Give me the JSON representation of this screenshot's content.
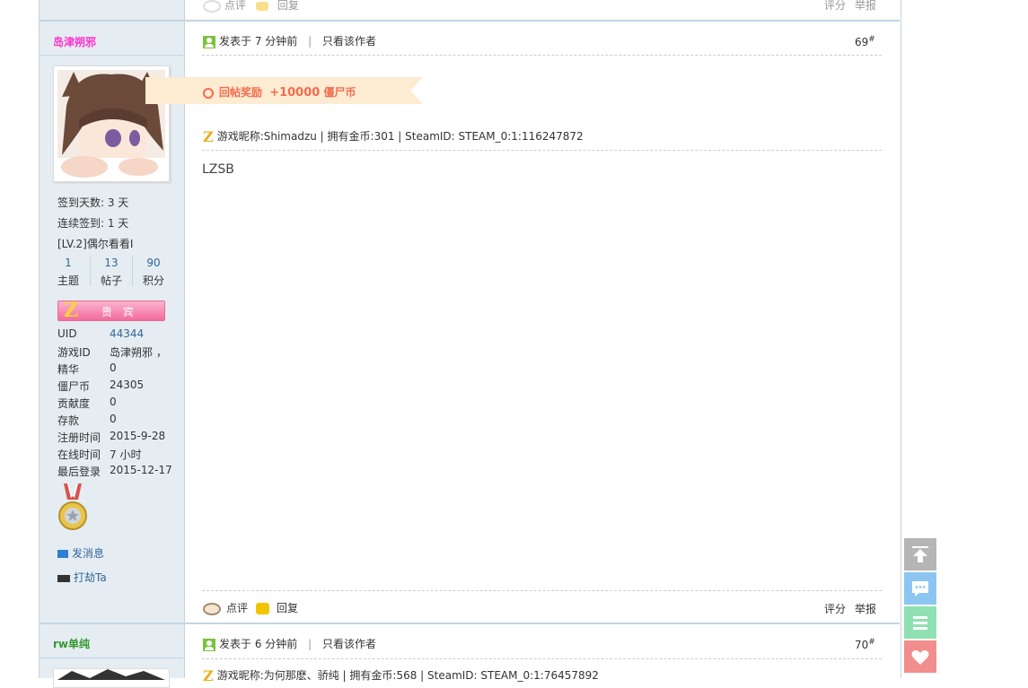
{
  "prev_post": {
    "comment": "点评",
    "reply": "回复",
    "rate": "评分",
    "report": "举报"
  },
  "post69": {
    "author": {
      "name": "岛津朔邪",
      "checkin_days": "签到天数: 3 天",
      "streak": "连续签到: 1 天",
      "level": "[LV.2]偶尔看看I",
      "stats": [
        {
          "value": "1",
          "label": "主题"
        },
        {
          "value": "13",
          "label": "帖子"
        },
        {
          "value": "90",
          "label": "积分"
        }
      ],
      "group_badge": "贵 宾",
      "info": [
        {
          "key": "UID",
          "value": "44344"
        },
        {
          "key": "游戏ID",
          "value": "岛津朔邪 ，"
        },
        {
          "key": "精华",
          "value": "0"
        },
        {
          "key": "僵尸币",
          "value": "24305"
        },
        {
          "key": "贡献度",
          "value": "0"
        },
        {
          "key": "存款",
          "value": "0"
        },
        {
          "key": "注册时间",
          "value": "2015-9-28"
        },
        {
          "key": "在线时间",
          "value": "7 小时"
        },
        {
          "key": "最后登录",
          "value": "2015-12-17"
        }
      ],
      "send_message": "发消息",
      "rob": "打劫Ta"
    },
    "posted": "发表于 7 分钟前",
    "sep": "|",
    "only_author": "只看该作者",
    "floor": "69",
    "floor_sup": "#",
    "reward_label": "回帖奖励",
    "reward_amount": "+10000",
    "reward_unit": "僵尸币",
    "game_info": "游戏昵称:Shimadzu | 拥有金币:301 | SteamID: STEAM_0:1:116247872",
    "content": "LZSB",
    "comment": "点评",
    "reply": "回复",
    "rate": "评分",
    "report": "举报"
  },
  "post70": {
    "author_name": "rw单纯",
    "posted": "发表于 6 分钟前",
    "sep": "|",
    "only_author": "只看该作者",
    "floor": "70",
    "floor_sup": "#",
    "game_info": "游戏昵称:为何那麽、骄纯 | 拥有金币:568 | SteamID: STEAM_0:1:76457892"
  },
  "colors": {
    "border": "#c2d5e3",
    "sidebar_bg": "#e5edf2",
    "reward_bg": "#fdebd2",
    "reward_text": "#f26c4f",
    "username": "#ff33cc",
    "username2": "#339933",
    "float_gray": "#b5b5b5",
    "float_blue": "#8cc6f0",
    "float_green": "#8fe0b3",
    "float_pink": "#f28d8d"
  }
}
